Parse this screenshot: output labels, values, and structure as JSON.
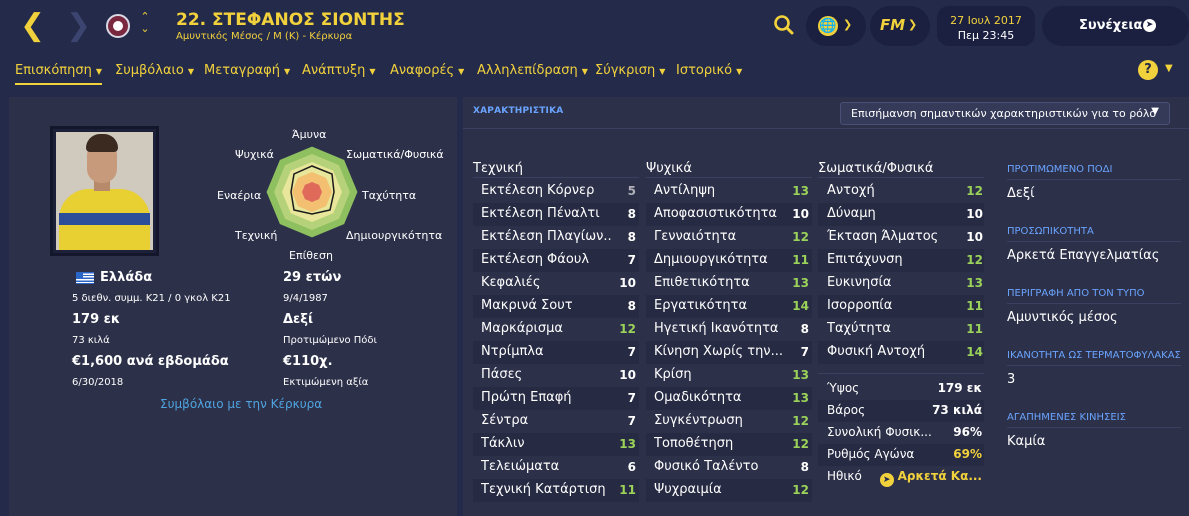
{
  "header": {
    "title": "22. ΣΤΕΦΑΝΟΣ ΣΙΟΝΤΗΣ",
    "subtitle": "Αμυντικός Μέσος / M (K) - Κέρκυρα",
    "date": "27 Ιουλ 2017",
    "time": "Πεμ 23:45",
    "continue": "Συνέχεια",
    "fm": "FM"
  },
  "tabs": [
    "Επισκόπηση",
    "Συμβόλαιο",
    "Μεταγραφή",
    "Ανάπτυξη",
    "Αναφορές",
    "Αλληλεπίδραση",
    "Σύγκριση",
    "Ιστορικό"
  ],
  "radar": {
    "labels": {
      "top": "Άμυνα",
      "tr": "Σωματικά/Φυσικά",
      "r": "Ταχύτητα",
      "br": "Δημιουργικότητα",
      "b": "Επίθεση",
      "bl": "Τεχνική",
      "l": "Εναέρια",
      "tl": "Ψυχικά"
    }
  },
  "profile": {
    "nation": "Ελλάδα",
    "caps": "5 διεθν. συμμ. K21 / 0 γκολ K21",
    "age": "29 ετών",
    "dob": "9/4/1987",
    "height": "179 εκ",
    "weight": "73 κιλά",
    "foot": "Δεξί",
    "foot_label": "Προτιμώμενο Πόδι",
    "wage": "€1,600 ανά εβδομάδα",
    "contract_end": "6/30/2018",
    "value": "€110χ.",
    "value_label": "Εκτιμώμενη αξία",
    "contract_link": "Συμβόλαιο με την Κέρκυρα"
  },
  "attributes": {
    "panel_title": "ΧΑΡΑΚΤΗΡΙΣΤΙΚΑ",
    "highlight": "Επισήμανση σημαντικών χαρακτηριστικών για το ρόλο",
    "technical_title": "Τεχνική",
    "mental_title": "Ψυχικά",
    "physical_title": "Σωματικά/Φυσικά",
    "technical": [
      {
        "n": "Εκτέλεση Κόρνερ",
        "v": "5",
        "c": "gray"
      },
      {
        "n": "Εκτέλεση Πέναλτι",
        "v": "8",
        "c": "white"
      },
      {
        "n": "Εκτέλεση Πλαγίων...",
        "v": "8",
        "c": "white"
      },
      {
        "n": "Εκτέλεση Φάουλ",
        "v": "7",
        "c": "white"
      },
      {
        "n": "Κεφαλιές",
        "v": "10",
        "c": "white"
      },
      {
        "n": "Μακρινά Σουτ",
        "v": "8",
        "c": "white"
      },
      {
        "n": "Μαρκάρισμα",
        "v": "12",
        "c": "green"
      },
      {
        "n": "Ντρίμπλα",
        "v": "7",
        "c": "white"
      },
      {
        "n": "Πάσες",
        "v": "10",
        "c": "white"
      },
      {
        "n": "Πρώτη Επαφή",
        "v": "7",
        "c": "white"
      },
      {
        "n": "Σέντρα",
        "v": "7",
        "c": "white"
      },
      {
        "n": "Τάκλιν",
        "v": "13",
        "c": "green"
      },
      {
        "n": "Τελειώματα",
        "v": "6",
        "c": "white"
      },
      {
        "n": "Τεχνική Κατάρτιση",
        "v": "11",
        "c": "green"
      }
    ],
    "mental": [
      {
        "n": "Αντίληψη",
        "v": "13",
        "c": "green"
      },
      {
        "n": "Αποφασιστικότητα",
        "v": "10",
        "c": "white"
      },
      {
        "n": "Γενναιότητα",
        "v": "12",
        "c": "green"
      },
      {
        "n": "Δημιουργικότητα",
        "v": "11",
        "c": "green"
      },
      {
        "n": "Επιθετικότητα",
        "v": "13",
        "c": "green"
      },
      {
        "n": "Εργατικότητα",
        "v": "14",
        "c": "green"
      },
      {
        "n": "Ηγετική Ικανότητα",
        "v": "8",
        "c": "white"
      },
      {
        "n": "Κίνηση Χωρίς την...",
        "v": "7",
        "c": "white"
      },
      {
        "n": "Κρίση",
        "v": "13",
        "c": "green"
      },
      {
        "n": "Ομαδικότητα",
        "v": "13",
        "c": "green"
      },
      {
        "n": "Συγκέντρωση",
        "v": "12",
        "c": "green"
      },
      {
        "n": "Τοποθέτηση",
        "v": "12",
        "c": "green"
      },
      {
        "n": "Φυσικό Ταλέντο",
        "v": "8",
        "c": "white"
      },
      {
        "n": "Ψυχραιμία",
        "v": "12",
        "c": "green"
      }
    ],
    "physical": [
      {
        "n": "Αντοχή",
        "v": "12",
        "c": "green"
      },
      {
        "n": "Δύναμη",
        "v": "10",
        "c": "white"
      },
      {
        "n": "Έκταση Άλματος",
        "v": "10",
        "c": "white"
      },
      {
        "n": "Επιτάχυνση",
        "v": "12",
        "c": "green"
      },
      {
        "n": "Ευκινησία",
        "v": "13",
        "c": "green"
      },
      {
        "n": "Ισορροπία",
        "v": "11",
        "c": "green"
      },
      {
        "n": "Ταχύτητα",
        "v": "11",
        "c": "green"
      },
      {
        "n": "Φυσική Αντοχή",
        "v": "14",
        "c": "green"
      }
    ],
    "extras": [
      {
        "n": "Ύψος",
        "v": "179 εκ",
        "c": "white"
      },
      {
        "n": "Βάρος",
        "v": "73 κιλά",
        "c": "white"
      },
      {
        "n": "Συνολική Φυσικ...",
        "v": "96%",
        "c": "white"
      },
      {
        "n": "Ρυθμός Αγώνα",
        "v": "69%",
        "c": "yellow"
      },
      {
        "n": "Ηθικό",
        "v": "Αρκετά Κα...",
        "c": "yellow"
      }
    ]
  },
  "side": [
    {
      "h": "ΠΡΟΤΙΜΩΜΕΝΟ ΠΟΔΙ",
      "v": "Δεξί"
    },
    {
      "h": "ΠΡΟΣΩΠΙΚΟΤΗΤΑ",
      "v": "Αρκετά Επαγγελματίας"
    },
    {
      "h": "ΠΕΡΙΓΡΑΦΗ ΑΠΟ ΤΟΝ ΤΥΠΟ",
      "v": "Αμυντικός μέσος"
    },
    {
      "h": "ΙΚΑΝΟΤΗΤΑ ΩΣ ΤΕΡΜΑΤΟΦΥΛΑΚΑΣ",
      "v": "3"
    },
    {
      "h": "ΑΓΑΠΗΜΕΝΕΣ ΚΙΝΗΣΕΙΣ",
      "v": "Καμία"
    }
  ],
  "colors": {
    "accent": "#f2d23c",
    "bg": "#242a4a",
    "panel": "#2c3049",
    "green": "#9bd25a",
    "blue_label": "#6aa4ff"
  }
}
